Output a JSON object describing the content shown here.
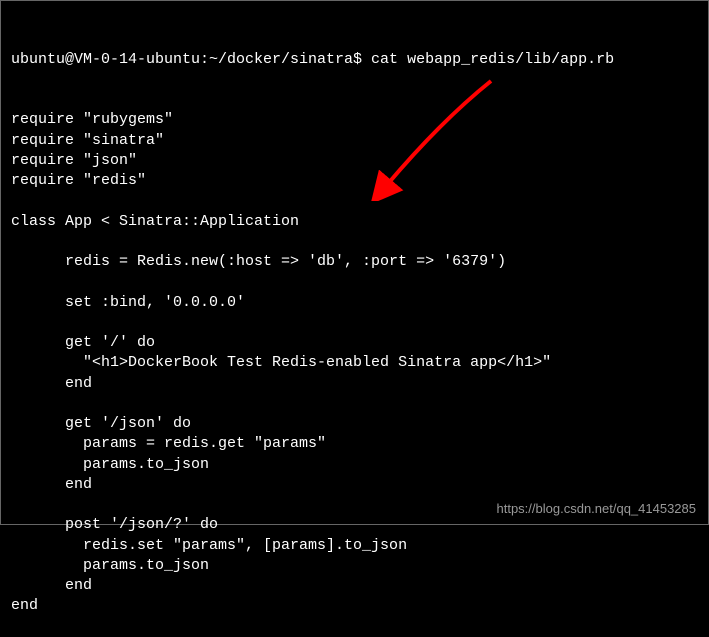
{
  "prompt": "ubuntu@VM-0-14-ubuntu:~/docker/sinatra$ cat webapp_redis/lib/app.rb",
  "code_lines": [
    "require \"rubygems\"",
    "require \"sinatra\"",
    "require \"json\"",
    "require \"redis\"",
    "",
    "class App < Sinatra::Application",
    "",
    "      redis = Redis.new(:host => 'db', :port => '6379')",
    "",
    "      set :bind, '0.0.0.0'",
    "",
    "      get '/' do",
    "        \"<h1>DockerBook Test Redis-enabled Sinatra app</h1>\"",
    "      end",
    "",
    "      get '/json' do",
    "        params = redis.get \"params\"",
    "        params.to_json",
    "      end",
    "",
    "      post '/json/?' do",
    "        redis.set \"params\", [params].to_json",
    "        params.to_json",
    "      end",
    "end"
  ],
  "watermark": "https://blog.csdn.net/qq_41453285",
  "arrow_color": "#ff0000"
}
